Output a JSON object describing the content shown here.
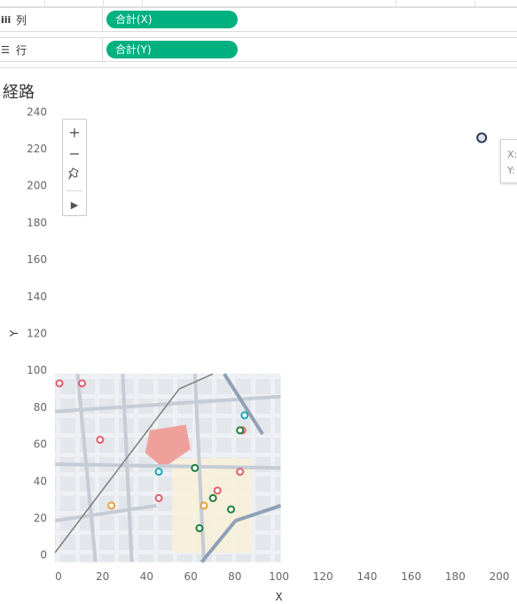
{
  "shelves": {
    "columns": {
      "icon": "iii",
      "label": "列",
      "pill": "合計(X)"
    },
    "rows": {
      "icon": "☰",
      "label": "行",
      "pill": "合計(Y)"
    }
  },
  "sheet_title": "経路",
  "toolbar": {
    "zoom_in": "+",
    "zoom_out": "−",
    "pin": "pin-icon",
    "expand": "▶"
  },
  "tooltip": {
    "x_label": "X:",
    "y_label": "Y:"
  },
  "colors": {
    "pill": "#00b180",
    "mark_stroke": "#2b3a55"
  },
  "chart_data": {
    "type": "scatter",
    "xlabel": "X",
    "ylabel": "Y",
    "xlim": [
      -2,
      206
    ],
    "ylim": [
      -4,
      244
    ],
    "x_ticks": [
      0,
      20,
      40,
      60,
      80,
      100,
      120,
      140,
      160,
      180,
      200
    ],
    "y_ticks": [
      0,
      20,
      40,
      60,
      80,
      100,
      120,
      140,
      160,
      180,
      200,
      220,
      240
    ],
    "points": [
      {
        "x": 192,
        "y": 226
      }
    ],
    "background_image": {
      "type": "map",
      "x_range": [
        0,
        100
      ],
      "y_range": [
        0,
        100
      ]
    }
  }
}
